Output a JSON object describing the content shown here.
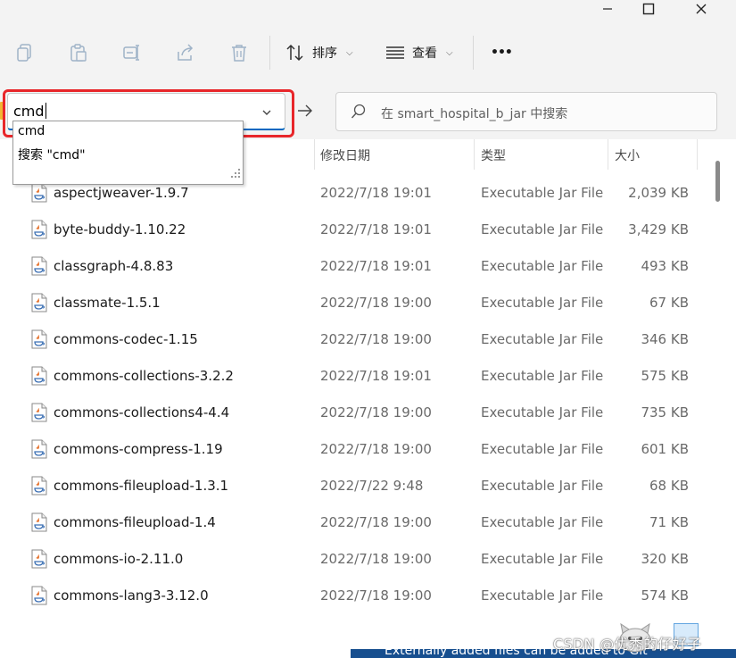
{
  "window": {
    "minimize_icon": "minimize-icon",
    "maximize_icon": "maximize-icon",
    "close_icon": "close-icon"
  },
  "toolbar": {
    "icons": [
      "copy-icon",
      "paste-icon",
      "rename-icon",
      "share-icon",
      "delete-icon"
    ],
    "sort_label": "排序",
    "view_label": "查看",
    "more_label": "•••"
  },
  "address": {
    "value": "cmd",
    "dropdown_items": [
      "cmd",
      "搜索 \"cmd\""
    ]
  },
  "search": {
    "placeholder": "在 smart_hospital_b_jar 中搜索"
  },
  "columns": {
    "date": "修改日期",
    "type": "类型",
    "size": "大小"
  },
  "files": [
    {
      "name": "aspectjweaver-1.9.7",
      "date": "2022/7/18 19:01",
      "type": "Executable Jar File",
      "size": "2,039 KB"
    },
    {
      "name": "byte-buddy-1.10.22",
      "date": "2022/7/18 19:01",
      "type": "Executable Jar File",
      "size": "3,429 KB"
    },
    {
      "name": "classgraph-4.8.83",
      "date": "2022/7/18 19:01",
      "type": "Executable Jar File",
      "size": "493 KB"
    },
    {
      "name": "classmate-1.5.1",
      "date": "2022/7/18 19:00",
      "type": "Executable Jar File",
      "size": "67 KB"
    },
    {
      "name": "commons-codec-1.15",
      "date": "2022/7/18 19:00",
      "type": "Executable Jar File",
      "size": "346 KB"
    },
    {
      "name": "commons-collections-3.2.2",
      "date": "2022/7/18 19:01",
      "type": "Executable Jar File",
      "size": "575 KB"
    },
    {
      "name": "commons-collections4-4.4",
      "date": "2022/7/18 19:00",
      "type": "Executable Jar File",
      "size": "735 KB"
    },
    {
      "name": "commons-compress-1.19",
      "date": "2022/7/18 19:00",
      "type": "Executable Jar File",
      "size": "601 KB"
    },
    {
      "name": "commons-fileupload-1.3.1",
      "date": "2022/7/22 9:48",
      "type": "Executable Jar File",
      "size": "68 KB"
    },
    {
      "name": "commons-fileupload-1.4",
      "date": "2022/7/18 19:00",
      "type": "Executable Jar File",
      "size": "71 KB"
    },
    {
      "name": "commons-io-2.11.0",
      "date": "2022/7/18 19:00",
      "type": "Executable Jar File",
      "size": "320 KB"
    },
    {
      "name": "commons-lang3-3.12.0",
      "date": "2022/7/18 19:00",
      "type": "Executable Jar File",
      "size": "574 KB"
    }
  ],
  "overlay": {
    "status_text": "Externally added files can be added to Git",
    "watermark": "CSDN @优秀的仔好子"
  },
  "colors": {
    "highlight": "#e8262a",
    "accent": "#0067c0",
    "status_bar": "#174f8f"
  }
}
